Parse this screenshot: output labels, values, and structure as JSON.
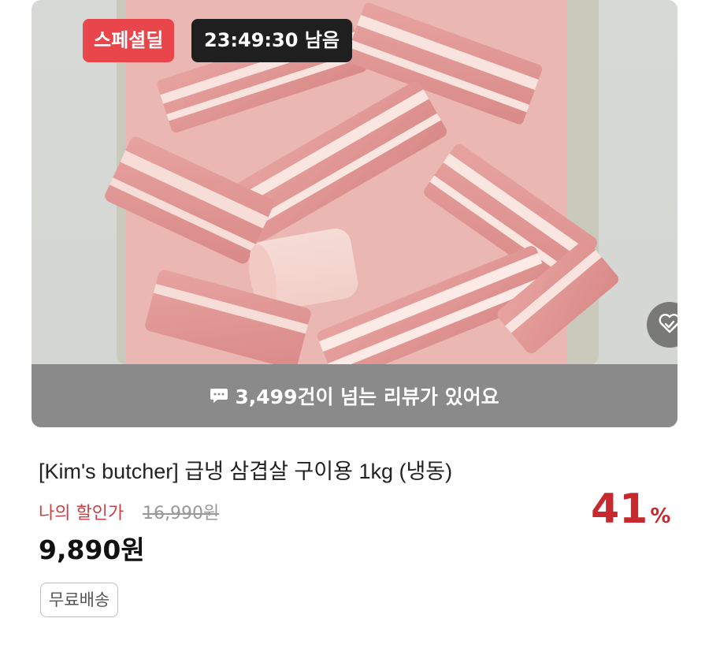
{
  "product": {
    "deal_badge": "스페셜딜",
    "timer": "23:49:30 남음",
    "review_text": "3,499건이 넘는 리뷰가 있어요",
    "title": "[Kim's butcher] 급냉 삼겹살 구이용 1kg (냉동)",
    "price_label": "나의 할인가",
    "original_price": "16,990원",
    "sale_price": "9,890원",
    "discount_value": "41",
    "discount_unit": "%",
    "shipping_tag": "무료배송"
  },
  "icons": {
    "wishlist": "heart-check-icon",
    "review": "chat-bubble-icon"
  },
  "colors": {
    "deal_badge": "#e8464a",
    "discount": "#c8292f",
    "price_label": "#c94147",
    "review_bar": "#8a8a8a"
  }
}
